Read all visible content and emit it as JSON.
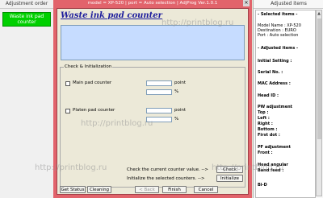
{
  "left_panel": {
    "title": "Adjustment order",
    "selected_item": "Waste ink pad counter"
  },
  "window": {
    "title": "model = XP-520 | port = Auto selection | AdjProg Ver.1.0.1",
    "heading": "Waste ink pad counter",
    "group_title": "Check & Initialization",
    "main_pad_label": "Main pad counter",
    "platen_pad_label": "Platen pad counter",
    "unit_point": "point",
    "unit_percent": "%",
    "check_text": "Check the current counter value. -->",
    "init_text": "Initialize the selected counters. -->",
    "check_button": "Check",
    "init_button": "Initialize",
    "get_status_button": "Get Status",
    "cleaning_button": "Cleaning",
    "back_button": "< Back",
    "finish_button": "Finish",
    "cancel_button": "Cancel"
  },
  "right_panel": {
    "title": "Adjusted items",
    "items": {
      "selected_items": "- Selected items -",
      "model_name": "Model Name : XP-520",
      "destination": "Destination : EURO",
      "port": "Port : Auto selection",
      "adjusted_items": "- Adjusted items -",
      "initial_setting": "Initial Setting :",
      "serial_no": "Serial No. :",
      "mac_address": "MAC Address :",
      "head_id": "Head ID :",
      "pw_adjustment": "PW adjustment",
      "top": "Top :",
      "left": "Left :",
      "right": "Right :",
      "bottom": "Bottom :",
      "first_dot": "First dot :",
      "pf_adjustment": "PF adjustment",
      "front": "Front :",
      "head_angular": "Head angular",
      "band_feed": "Band feed :",
      "bi_d": "Bi-D"
    }
  },
  "watermark": "http://printblog.ru",
  "colors": {
    "window_frame": "#e2636b",
    "selected_item_bg": "#00d000",
    "heading_text": "#1c1c9c",
    "description_box": "#c6dcff",
    "watermark": "#969696"
  }
}
